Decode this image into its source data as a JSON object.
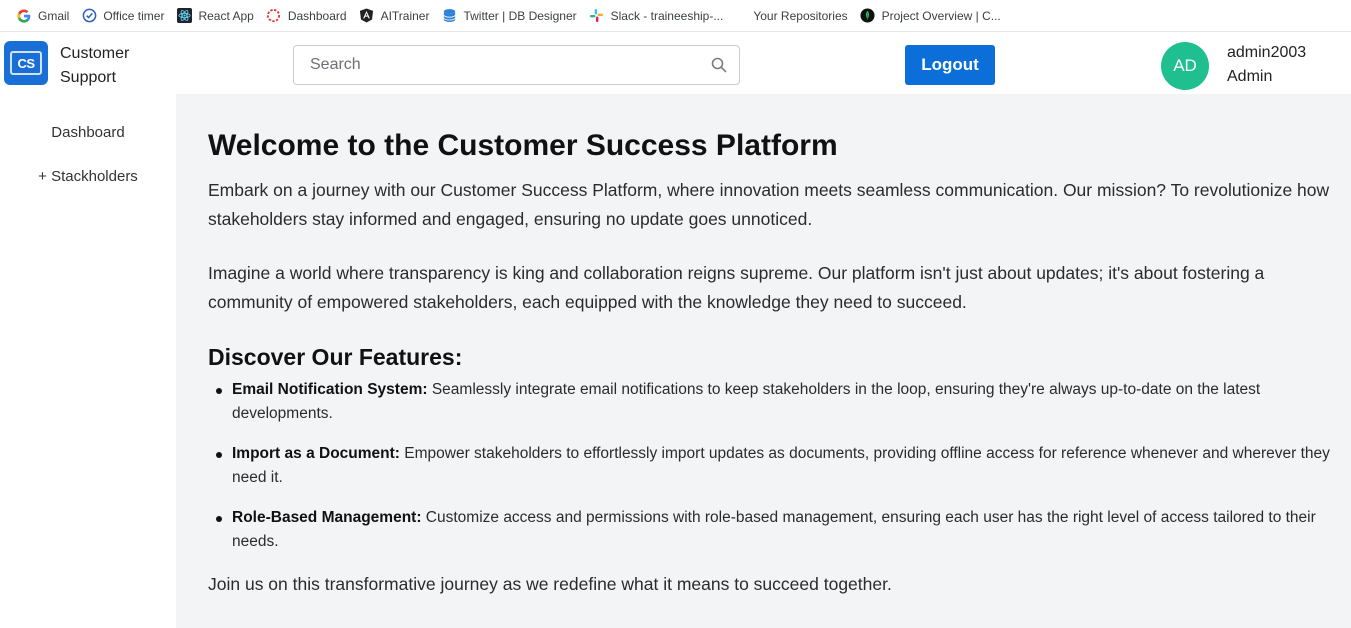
{
  "bookmarks": [
    {
      "label": "Gmail",
      "icon": "google-g-icon"
    },
    {
      "label": "Office timer",
      "icon": "timer-check-icon"
    },
    {
      "label": "React App",
      "icon": "react-app-icon"
    },
    {
      "label": "Dashboard",
      "icon": "dashboard-ring-icon"
    },
    {
      "label": "AITrainer",
      "icon": "angular-icon"
    },
    {
      "label": "Twitter | DB Designer",
      "icon": "database-icon"
    },
    {
      "label": "Slack - traineeship-...",
      "icon": "slack-icon"
    },
    {
      "label": "Your Repositories",
      "icon": ""
    },
    {
      "label": "Project Overview | C...",
      "icon": "leaf-icon"
    }
  ],
  "header": {
    "logo_text": "CS",
    "brand_line1": "Customer",
    "brand_line2": "Support",
    "search_placeholder": "Search",
    "logout_label": "Logout",
    "avatar_initials": "AD",
    "username": "admin2003",
    "role": "Admin"
  },
  "sidebar": {
    "items": [
      {
        "label": "Dashboard"
      },
      {
        "label": "+ Stackholders"
      }
    ]
  },
  "main": {
    "title": "Welcome to the Customer Success Platform",
    "intro1": "Embark on a journey with our Customer Success Platform, where innovation meets seamless communication. Our mission? To revolutionize how stakeholders stay informed and engaged, ensuring no update goes unnoticed.",
    "intro2": "Imagine a world where transparency is king and collaboration reigns supreme. Our platform isn't just about updates; it's about fostering a community of empowered stakeholders, each equipped with the knowledge they need to succeed.",
    "features_title": "Discover Our Features:",
    "features": [
      {
        "name": "Email Notification System:",
        "text": " Seamlessly integrate email notifications to keep stakeholders in the loop, ensuring they're always up-to-date on the latest developments."
      },
      {
        "name": "Import as a Document:",
        "text": " Empower stakeholders to effortlessly import updates as documents, providing offline access for reference whenever and wherever they need it."
      },
      {
        "name": "Role-Based Management:",
        "text": " Customize access and permissions with role-based management, ensuring each user has the right level of access tailored to their needs."
      }
    ],
    "closing": "Join us on this transformative journey as we redefine what it means to succeed together."
  },
  "colors": {
    "primary_button": "#0b6ed9",
    "avatar_bg": "#1fbf8f",
    "logo_bg": "#1a6fd6",
    "main_bg": "#f3f4f6"
  }
}
